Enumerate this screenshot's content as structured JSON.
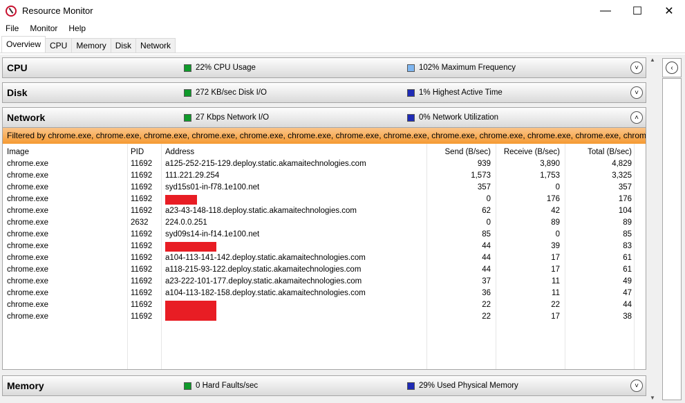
{
  "window": {
    "title": "Resource Monitor",
    "minimize": "—",
    "maximize": "☐",
    "close": "✕"
  },
  "menu": [
    "File",
    "Monitor",
    "Help"
  ],
  "tabs": [
    "Overview",
    "CPU",
    "Memory",
    "Disk",
    "Network"
  ],
  "sections": {
    "cpu": {
      "title": "CPU",
      "metric1": "22% CPU Usage",
      "metric2": "102% Maximum Frequency",
      "chevron": "˅"
    },
    "disk": {
      "title": "Disk",
      "metric1": "272 KB/sec Disk I/O",
      "metric2": "1% Highest Active Time",
      "chevron": "˅"
    },
    "network": {
      "title": "Network",
      "metric1": "27 Kbps Network I/O",
      "metric2": "0% Network Utilization",
      "chevron": "˄"
    },
    "memory": {
      "title": "Memory",
      "metric1": "0 Hard Faults/sec",
      "metric2": "29% Used Physical Memory",
      "chevron": "˅"
    }
  },
  "filter_text": "Filtered by chrome.exe, chrome.exe, chrome.exe, chrome.exe, chrome.exe, chrome.exe, chrome.exe, chrome.exe, chrome.exe, chrome.exe, chrome.exe, chrome.exe, chrom...",
  "table": {
    "headers": {
      "image": "Image",
      "pid": "PID",
      "address": "Address",
      "send": "Send (B/sec)",
      "receive": "Receive (B/sec)",
      "total": "Total (B/sec)"
    },
    "rows": [
      {
        "image": "chrome.exe",
        "pid": "11692",
        "address": "a125-252-215-129.deploy.static.akamaitechnologies.com",
        "send": "939",
        "receive": "3,890",
        "total": "4,829"
      },
      {
        "image": "chrome.exe",
        "pid": "11692",
        "address": "111.221.29.254",
        "send": "1,573",
        "receive": "1,753",
        "total": "3,325"
      },
      {
        "image": "chrome.exe",
        "pid": "11692",
        "address": "syd15s01-in-f78.1e100.net",
        "send": "357",
        "receive": "0",
        "total": "357"
      },
      {
        "image": "chrome.exe",
        "pid": "11692",
        "address": "",
        "redacted": "small",
        "send": "0",
        "receive": "176",
        "total": "176"
      },
      {
        "image": "chrome.exe",
        "pid": "11692",
        "address": "a23-43-148-118.deploy.static.akamaitechnologies.com",
        "send": "62",
        "receive": "42",
        "total": "104"
      },
      {
        "image": "chrome.exe",
        "pid": "2632",
        "address": "224.0.0.251",
        "send": "0",
        "receive": "89",
        "total": "89"
      },
      {
        "image": "chrome.exe",
        "pid": "11692",
        "address": "syd09s14-in-f14.1e100.net",
        "send": "85",
        "receive": "0",
        "total": "85"
      },
      {
        "image": "chrome.exe",
        "pid": "11692",
        "address": "",
        "redacted": "medium",
        "send": "44",
        "receive": "39",
        "total": "83"
      },
      {
        "image": "chrome.exe",
        "pid": "11692",
        "address": "a104-113-141-142.deploy.static.akamaitechnologies.com",
        "send": "44",
        "receive": "17",
        "total": "61"
      },
      {
        "image": "chrome.exe",
        "pid": "11692",
        "address": "a118-215-93-122.deploy.static.akamaitechnologies.com",
        "send": "44",
        "receive": "17",
        "total": "61"
      },
      {
        "image": "chrome.exe",
        "pid": "11692",
        "address": "a23-222-101-177.deploy.static.akamaitechnologies.com",
        "send": "37",
        "receive": "11",
        "total": "49"
      },
      {
        "image": "chrome.exe",
        "pid": "11692",
        "address": "a104-113-182-158.deploy.static.akamaitechnologies.com",
        "send": "36",
        "receive": "11",
        "total": "47"
      },
      {
        "image": "chrome.exe",
        "pid": "11692",
        "address": "",
        "redacted": "large",
        "send": "22",
        "receive": "22",
        "total": "44"
      },
      {
        "image": "chrome.exe",
        "pid": "11692",
        "address": "",
        "redacted": "large-cont",
        "send": "22",
        "receive": "17",
        "total": "38"
      }
    ]
  },
  "sidebar": {
    "collapse": "‹"
  },
  "icons": {
    "app": "resource-monitor-icon",
    "chevron_down": "chevron-down-icon",
    "chevron_up": "chevron-up-icon"
  },
  "colors": {
    "green": "#0f9a2a",
    "blue": "#1f2bb5",
    "lightblue": "#7fb6f0",
    "filter": "#f59a32",
    "redact": "#e81d24"
  }
}
